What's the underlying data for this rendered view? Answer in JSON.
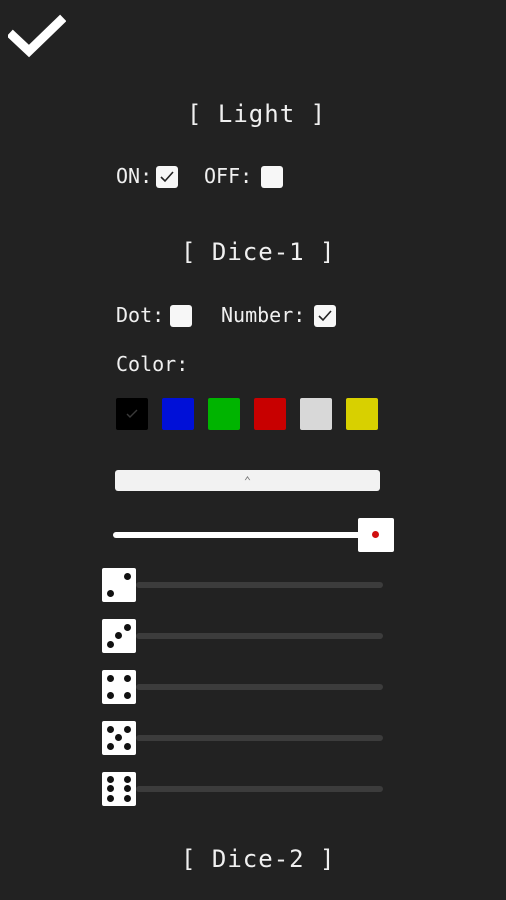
{
  "toolbar": {
    "confirm_icon": "checkmark-icon"
  },
  "light": {
    "heading": "[ Light ]",
    "on_label": "ON:",
    "on_checked": true,
    "off_label": "OFF:",
    "off_checked": false
  },
  "dice1": {
    "heading": "[ Dice-1 ]",
    "dot_label": "Dot:",
    "dot_checked": false,
    "number_label": "Number:",
    "number_checked": true,
    "color_label": "Color:",
    "colors": [
      {
        "name": "black",
        "hex": "#000000",
        "selected": true
      },
      {
        "name": "blue",
        "hex": "#0010d8",
        "selected": false
      },
      {
        "name": "green",
        "hex": "#00b400",
        "selected": false
      },
      {
        "name": "red",
        "hex": "#c80000",
        "selected": false
      },
      {
        "name": "light-gray",
        "hex": "#d8d8d8",
        "selected": false
      },
      {
        "name": "yellow",
        "hex": "#d8d000",
        "selected": false
      }
    ],
    "collapse_icon": "chevron-up-icon",
    "main_slider_value": 1.0,
    "face_sliders": [
      {
        "face": 2,
        "value": 0
      },
      {
        "face": 3,
        "value": 0
      },
      {
        "face": 4,
        "value": 0
      },
      {
        "face": 5,
        "value": 0
      },
      {
        "face": 6,
        "value": 0
      }
    ]
  },
  "dice2": {
    "heading": "[ Dice-2 ]"
  }
}
